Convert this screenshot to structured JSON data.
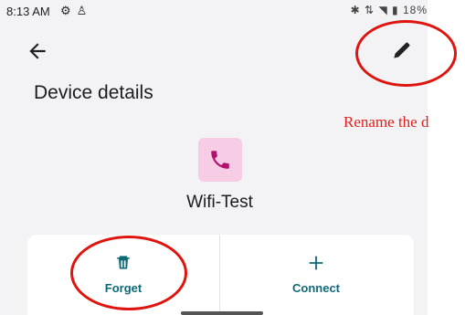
{
  "status_bar": {
    "time": "8:13 AM",
    "left_icons": [
      "settings-icon",
      "person-icon"
    ],
    "right_icons": [
      "bluetooth-icon",
      "data-icon",
      "wifi-icon",
      "battery-icon"
    ],
    "right_text": "18%"
  },
  "toolbar": {
    "back_icon": "arrow-back-icon",
    "edit_icon": "pencil-icon"
  },
  "page": {
    "title": "Device details"
  },
  "device": {
    "icon": "phone-icon",
    "icon_bg": "#f7cde6",
    "icon_color": "#b0126e",
    "name": "Wifi-Test"
  },
  "actions": [
    {
      "label": "Forget",
      "icon": "trash-icon"
    },
    {
      "label": "Connect",
      "icon": "plus-icon"
    }
  ],
  "annotation": {
    "text": "Rename the d",
    "color": "#e0201a"
  },
  "accent_color": "#0e6a78"
}
